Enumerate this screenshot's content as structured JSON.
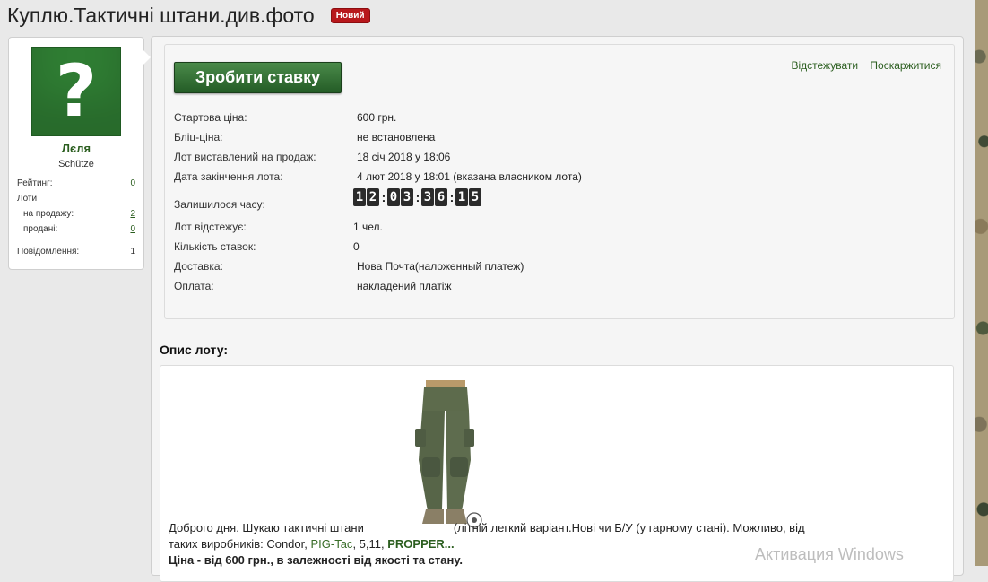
{
  "page": {
    "title": "Куплю.Тактичні штани.див.фото",
    "badge": "Новий"
  },
  "sidebar": {
    "avatar_symbol": "?",
    "user_name": "Лєля",
    "user_title": "Schütze",
    "stats": [
      {
        "label": "Рейтинг:",
        "value": "0",
        "link": true
      },
      {
        "label": "Лоти",
        "value": "",
        "link": false
      },
      {
        "label": "на продажу:",
        "value": "2",
        "link": true
      },
      {
        "label": "продані:",
        "value": "0",
        "link": true
      },
      {
        "label": "Повідомлення:",
        "value": "1",
        "link": false
      }
    ]
  },
  "actions": {
    "bid_button": "Зробити ставку",
    "watch": "Відстежувати",
    "report": "Поскаржитися"
  },
  "lot": {
    "fields": [
      {
        "label": "Стартова ціна:",
        "value": "600 грн."
      },
      {
        "label": "Бліц-ціна:",
        "value": "не встановлена"
      },
      {
        "label": "Лот виставлений на продаж:",
        "value": "18 січ 2018 у 18:06"
      },
      {
        "label": "Дата закінчення лота:",
        "value": "4 лют 2018 у 18:01 (вказана власником лота)"
      },
      {
        "label": "Залишилося часу:",
        "value": ""
      },
      {
        "label": "Лот відстежує:",
        "value": "1 чел."
      },
      {
        "label": "Кількість ставок:",
        "value": "0"
      },
      {
        "label": "Доставка:",
        "value": "Нова Почта(наложенный платеж)"
      },
      {
        "label": "Оплата:",
        "value": "накладений платіж"
      }
    ],
    "timer": [
      "12",
      "03",
      "36",
      "15"
    ]
  },
  "description": {
    "title": "Опис лоту:",
    "line1_before": "Доброго дня. Шукаю тактичні штани",
    "line1_after": "(літній легкий варіант.Нові чи Б/У (у гарному стані). Можливо, від",
    "line2_prefix": "таких виробників: Condor, ",
    "brand_pig": "PIG-Tac",
    "line2_mid": ", 5,11, ",
    "brand_propper": "PROPPER...",
    "line3": "Ціна - від 600 грн., в залежності від якості та стану."
  },
  "os_watermark": "Активация Windows"
}
